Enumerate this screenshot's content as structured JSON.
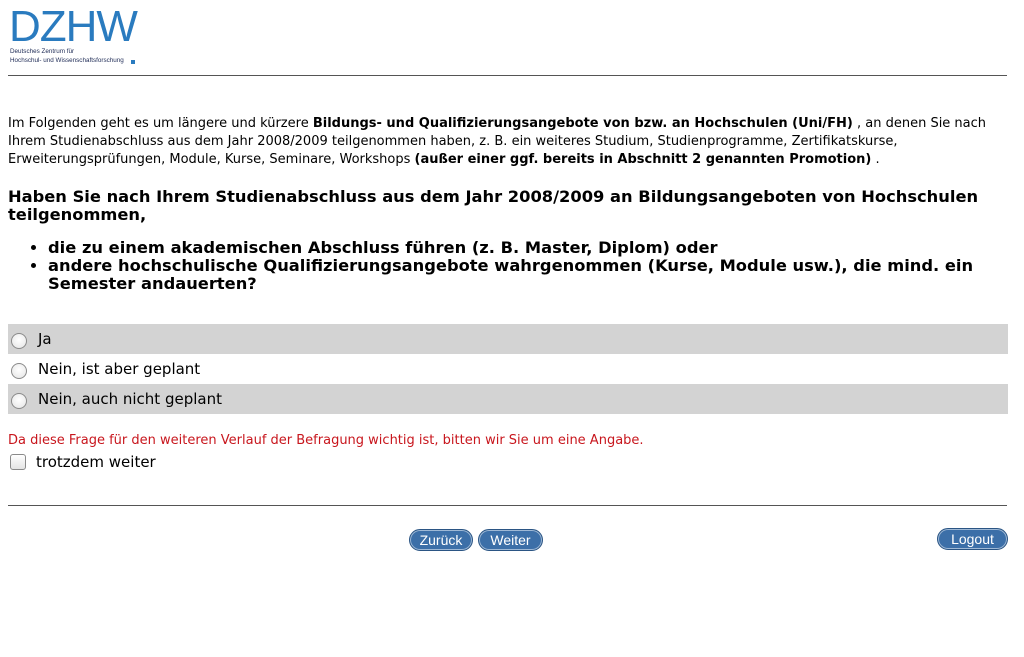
{
  "logo": {
    "wordmark": "DZHW",
    "line1": "Deutsches Zentrum für",
    "line2": "Hochschul- und Wissenschaftsforschung",
    "brand_color": "#2a7bbf"
  },
  "intro": {
    "part1": "Im Folgenden geht es um längere und kürzere ",
    "bold1": "Bildungs- und Qualifizierungsangebote von bzw. an Hochschulen (Uni/FH)",
    "part2": " , an denen Sie nach Ihrem Studienabschluss aus dem Jahr 2008/2009 teilgenommen haben, z. B. ein weiteres Studium, Studienprogramme, Zertifikatskurse, Erweiterungsprüfungen, Module, Kurse, Seminare, Workshops ",
    "bold2": "(außer einer ggf. bereits in Abschnitt 2 genannten Promotion)",
    "part3": " ."
  },
  "question": {
    "text": "Haben Sie nach Ihrem Studienabschluss aus dem Jahr 2008/2009 an Bildungsangeboten von Hochschulen teilgenommen,",
    "bullets": [
      "die zu einem akademischen Abschluss führen (z. B. Master, Diplom) oder",
      "andere hochschulische Qualifizierungsangebote wahrgenommen (Kurse, Module usw.), die mind. ein Semester andauerten?"
    ]
  },
  "options": [
    "Ja",
    "Nein, ist aber geplant",
    "Nein, auch nicht geplant"
  ],
  "warning": "Da diese Frage für den weiteren Verlauf der Befragung wichtig ist, bitten wir Sie um eine Angabe.",
  "continue_anyway": "trotzdem weiter",
  "buttons": {
    "back": "Zurück",
    "next": "Weiter",
    "logout": "Logout"
  },
  "colors": {
    "button": "#3c6fa8",
    "warning": "#c8161d",
    "option_shade": "#d3d3d3"
  }
}
